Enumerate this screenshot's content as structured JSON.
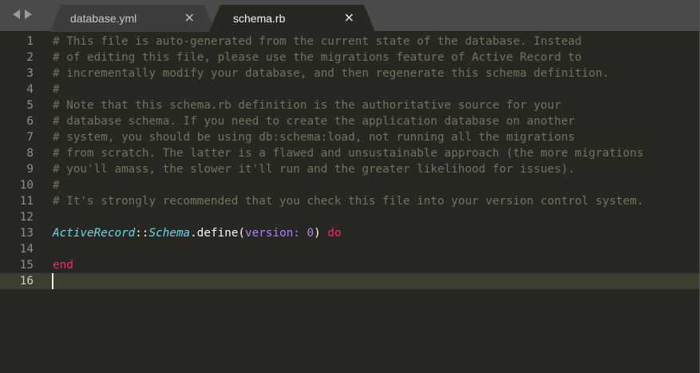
{
  "tabs": [
    {
      "label": "database.yml",
      "close": "×"
    },
    {
      "label": "schema.rb",
      "close": "×"
    }
  ],
  "lines": [
    {
      "n": "1",
      "text": "# This file is auto-generated from the current state of the database. Instead"
    },
    {
      "n": "2",
      "text": "# of editing this file, please use the migrations feature of Active Record to"
    },
    {
      "n": "3",
      "text": "# incrementally modify your database, and then regenerate this schema definition."
    },
    {
      "n": "4",
      "text": "#"
    },
    {
      "n": "5",
      "text": "# Note that this schema.rb definition is the authoritative source for your"
    },
    {
      "n": "6",
      "text": "# database schema. If you need to create the application database on another"
    },
    {
      "n": "7",
      "text": "# system, you should be using db:schema:load, not running all the migrations"
    },
    {
      "n": "8",
      "text": "# from scratch. The latter is a flawed and unsustainable approach (the more migrations"
    },
    {
      "n": "9",
      "text": "# you'll amass, the slower it'll run and the greater likelihood for issues)."
    },
    {
      "n": "10",
      "text": "#"
    },
    {
      "n": "11",
      "text": "# It's strongly recommended that you check this file into your version control system."
    },
    {
      "n": "12",
      "text": ""
    },
    {
      "n": "13",
      "tokens": [
        {
          "t": "ActiveRecord",
          "k": "const"
        },
        {
          "t": "::",
          "k": "plain"
        },
        {
          "t": "Schema",
          "k": "const"
        },
        {
          "t": ".define(",
          "k": "plain"
        },
        {
          "t": "version:",
          "k": "sym"
        },
        {
          "t": " ",
          "k": "plain"
        },
        {
          "t": "0",
          "k": "sym"
        },
        {
          "t": ") ",
          "k": "plain"
        },
        {
          "t": "do",
          "k": "kw"
        }
      ]
    },
    {
      "n": "14",
      "text": ""
    },
    {
      "n": "15",
      "tokens": [
        {
          "t": "end",
          "k": "kw"
        }
      ]
    },
    {
      "n": "16",
      "text": "",
      "current": true
    }
  ],
  "colors": {
    "background": "#272822",
    "comment": "#75715e",
    "constant": "#66d9ef",
    "symbol": "#ae81ff",
    "keyword": "#f92672",
    "current_line": "#3e3d32"
  },
  "icons": {
    "nav_back": "chevron-left-icon",
    "nav_forward": "chevron-right-icon",
    "tab_close": "close-icon"
  }
}
